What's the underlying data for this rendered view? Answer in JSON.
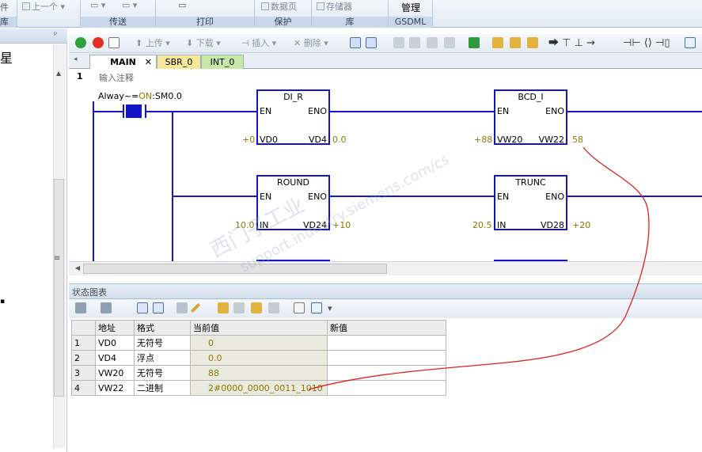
{
  "ribbon": {
    "groups": [
      {
        "label": "库",
        "extra_left": "件"
      },
      {
        "label": "传送"
      },
      {
        "label": "打印"
      },
      {
        "label": "保护",
        "button": "数据页"
      },
      {
        "label": "库",
        "button": "存储器"
      },
      {
        "label": "GSDML",
        "button": "管理"
      }
    ],
    "prev_btn": "上一个"
  },
  "leftpanel": {
    "pin": "ᵖ",
    "heading": "星"
  },
  "toolbar": {
    "upload": "上传",
    "download": "下载",
    "insert": "插入",
    "delete": "删除"
  },
  "tabs": [
    {
      "label": "MAIN",
      "active": true
    },
    {
      "label": "SBR_0"
    },
    {
      "label": "INT_0"
    }
  ],
  "ladder": {
    "network_number": "1",
    "comment": "输入注释",
    "contact": {
      "label_pre": "Alway~=",
      "label_on": "ON",
      "label_post": ":SM0.0"
    },
    "blocks": [
      {
        "title": "DI_R",
        "en": "EN",
        "eno": "ENO",
        "in_pin": "VD0",
        "out_pin": "VD4",
        "in_val": "+0",
        "out_val": "0.0"
      },
      {
        "title": "BCD_I",
        "en": "EN",
        "eno": "ENO",
        "in_pin": "VW20",
        "out_pin": "VW22",
        "in_val": "+88",
        "out_val": "58"
      },
      {
        "title": "ROUND",
        "en": "EN",
        "eno": "ENO",
        "in_pin": "IN",
        "out_pin": "VD24",
        "in_val": "10.0",
        "out_val": "+10"
      },
      {
        "title": "TRUNC",
        "en": "EN",
        "eno": "ENO",
        "in_pin": "IN",
        "out_pin": "VD28",
        "in_val": "20.5",
        "out_val": "+20"
      }
    ]
  },
  "status": {
    "title": "状态图表",
    "headers": [
      "地址",
      "格式",
      "当前值",
      "新值"
    ],
    "rows": [
      {
        "idx": "1",
        "addr": "VD0",
        "fmt": "无符号",
        "cur": "0",
        "new": ""
      },
      {
        "idx": "2",
        "addr": "VD4",
        "fmt": "浮点",
        "cur": "0.0",
        "new": ""
      },
      {
        "idx": "3",
        "addr": "VW20",
        "fmt": "无符号",
        "cur": "88",
        "new": ""
      },
      {
        "idx": "4",
        "addr": "VW22",
        "fmt": "二进制",
        "cur": "2#0000_0000_0011_1010",
        "new": ""
      }
    ]
  },
  "watermark": {
    "line1": "西门子工业",
    "line2": "support.industry.siemens.com/cs"
  },
  "colors": {
    "ladder": "#1414c8",
    "annotation": "#e02020",
    "value": "#8a7a00"
  }
}
